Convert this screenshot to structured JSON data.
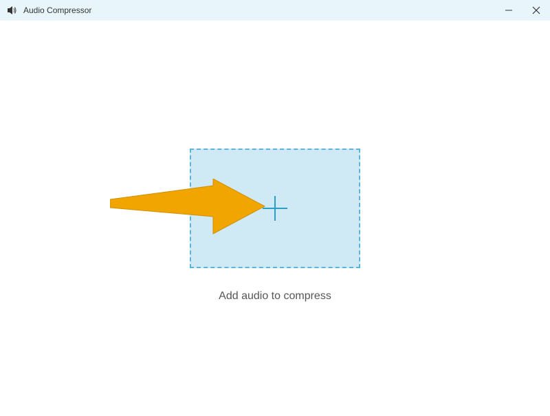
{
  "window": {
    "title": "Audio Compressor"
  },
  "main": {
    "caption": "Add audio to compress"
  },
  "colors": {
    "titlebar_bg": "#e8f5fa",
    "dropzone_border": "#5bb5d8",
    "dropzone_bg": "#cfeaf5",
    "arrow": "#f0a500"
  }
}
